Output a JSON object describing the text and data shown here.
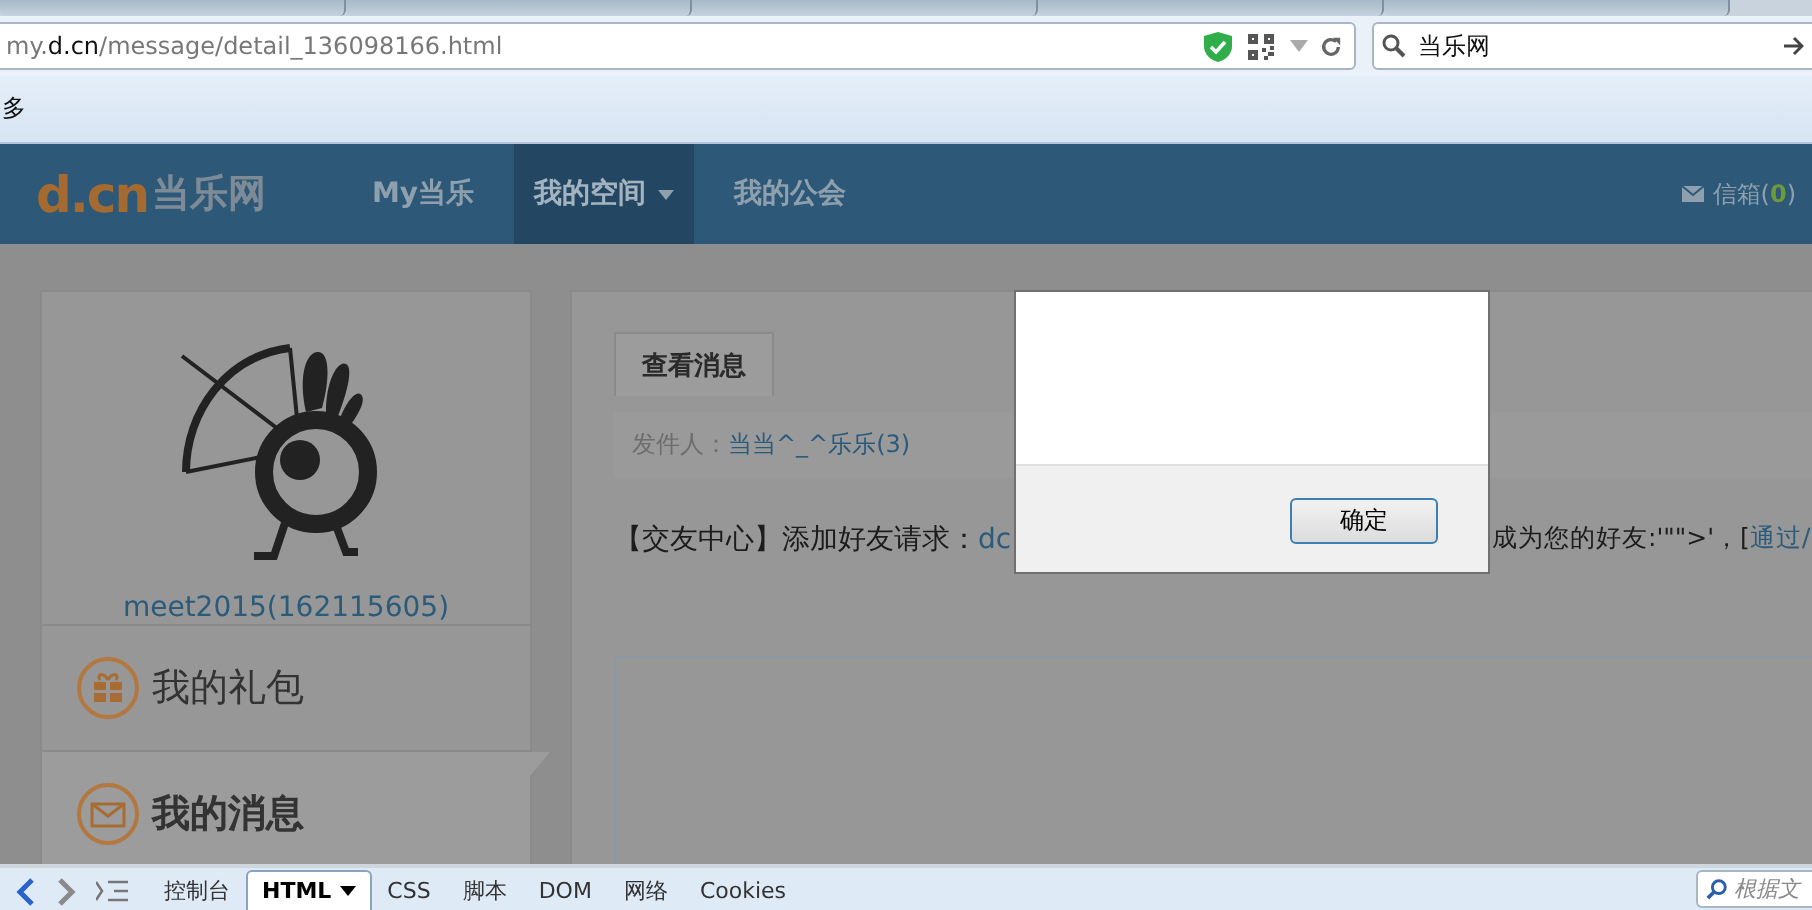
{
  "address_bar": {
    "url": "my.**d.cn**/message/detail_136098166.html"
  },
  "search_box": {
    "value": "当乐网"
  },
  "bookmarks_bar": {
    "items": [
      "多"
    ]
  },
  "site_header": {
    "logo": {
      "mark": "d.cn",
      "name": "当乐网"
    },
    "nav": [
      {
        "label": "My当乐",
        "selected": false,
        "dropdown": false
      },
      {
        "label": "我的空间",
        "selected": true,
        "dropdown": true
      },
      {
        "label": "我的公会",
        "selected": false,
        "dropdown": false
      }
    ],
    "mailbox": {
      "prefix": "信箱(",
      "count": "0",
      "suffix": ")"
    }
  },
  "sidebar": {
    "user_name": "meet2015(162115605)",
    "menu": [
      {
        "label": "我的礼包",
        "selected": false
      },
      {
        "label": "我的消息",
        "selected": true
      }
    ]
  },
  "message_panel": {
    "tab": {
      "label": "查看消息",
      "selected": true
    },
    "sender": {
      "label": "发件人：",
      "name": "当当^_^乐乐(3)"
    },
    "message": {
      "prefix": "【交友中心】添加好友请求：",
      "link": "dc",
      "after": "成为您的好友:'\"\">'，[",
      "action_link": "通过/"
    }
  },
  "dialog": {
    "button": "确定"
  },
  "devtools": {
    "tabs": [
      {
        "label": "控制台",
        "selected": false,
        "dropdown": false
      },
      {
        "label": "HTML",
        "selected": true,
        "dropdown": true
      },
      {
        "label": "CSS",
        "selected": false,
        "dropdown": false
      },
      {
        "label": "脚本",
        "selected": false,
        "dropdown": false
      },
      {
        "label": "DOM",
        "selected": false,
        "dropdown": false
      },
      {
        "label": "网络",
        "selected": false,
        "dropdown": false
      },
      {
        "label": "Cookies",
        "selected": false,
        "dropdown": false
      }
    ],
    "search_placeholder": "根据文"
  }
}
